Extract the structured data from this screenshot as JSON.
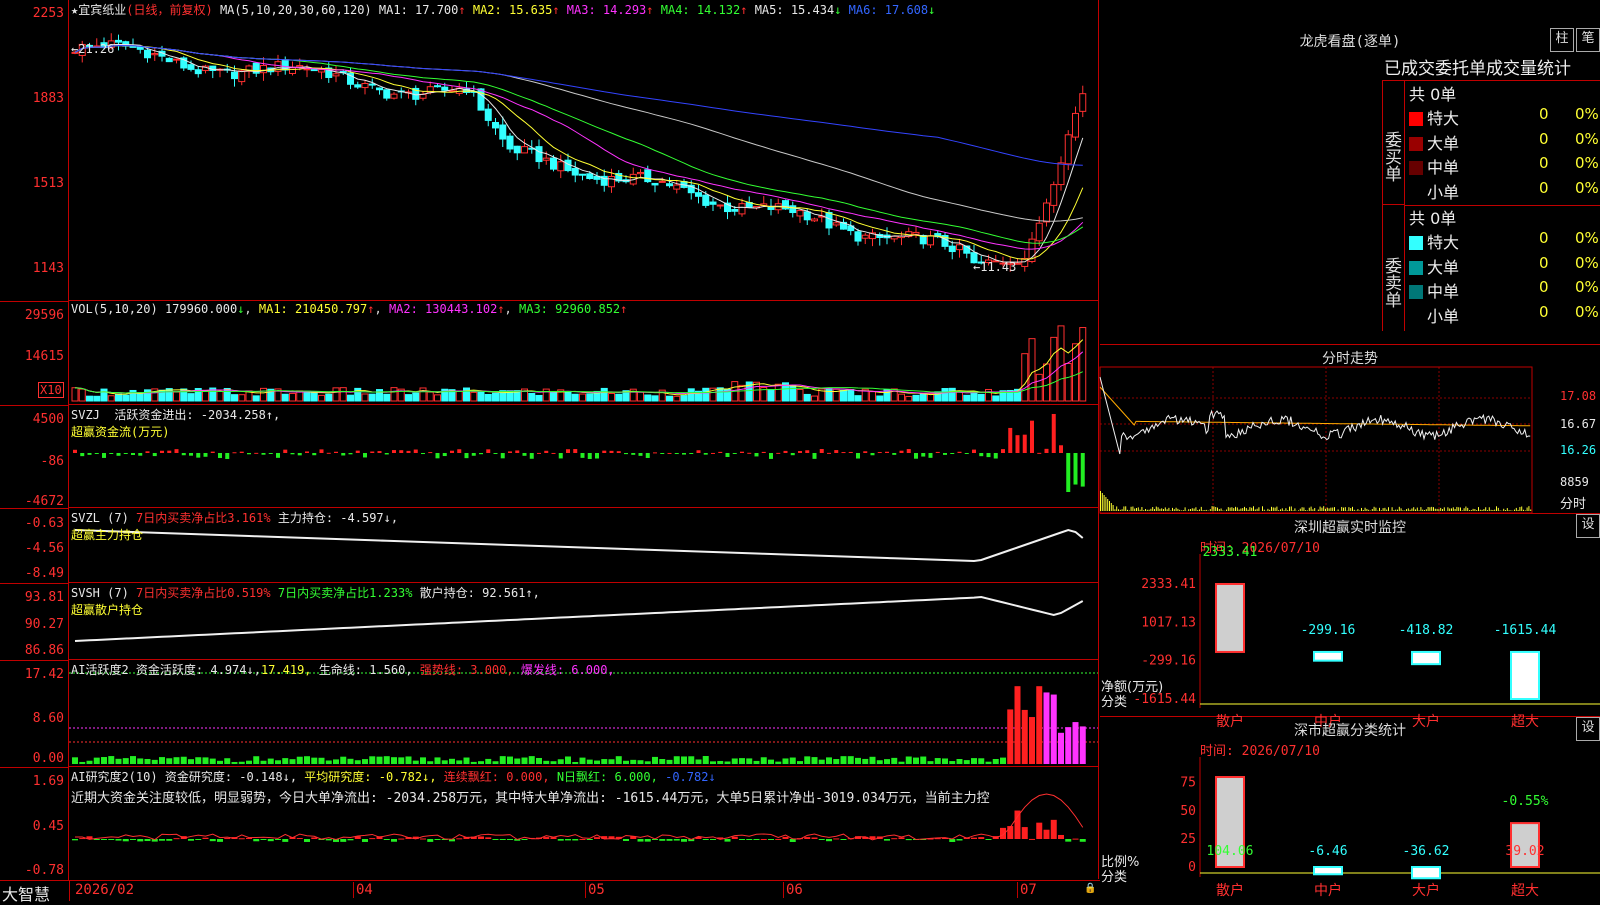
{
  "app": {
    "name": "大智慧"
  },
  "stock": {
    "name": "宜宾纸业",
    "period": "(日线，前复权)"
  },
  "main_panel": {
    "yticks": [
      "2253",
      "1883",
      "1513",
      "1143"
    ],
    "ma_label": "MA(5,10,20,30,60,120)",
    "ma": [
      {
        "label": "MA1: 17.700",
        "arrow": "↑",
        "color": "#e8e8e8"
      },
      {
        "label": "MA2: 15.635",
        "arrow": "↑",
        "color": "#ffff33"
      },
      {
        "label": "MA3: 14.293",
        "arrow": "↑",
        "color": "#ff33ff"
      },
      {
        "label": "MA4: 14.132",
        "arrow": "↑",
        "color": "#33ff33"
      },
      {
        "label": "MA5: 15.434",
        "arrow": "↓",
        "color": "#e8e8e8"
      },
      {
        "label": "MA6: 17.608",
        "arrow": "↓",
        "color": "#3366ff"
      }
    ],
    "high_marker": "←21.26",
    "low_marker": "←11.43"
  },
  "vol_panel": {
    "yticks": [
      "29596",
      "14615"
    ],
    "unit": "X10",
    "title": "VOL(5,10,20)",
    "vol": "179960.000",
    "vol_arrow": "↓",
    "ma1": "MA1: 210450.797",
    "ma2": "MA2: 130443.102",
    "ma3": "MA3: 92960.852",
    "arrow_up": "↑"
  },
  "svzj_panel": {
    "yticks": [
      "4500",
      "-86",
      "-4672"
    ],
    "title": "SVZJ",
    "line1": "活跃资金进出: -2034.258↑,",
    "line2": "超赢资金流(万元)"
  },
  "svzl_panel": {
    "yticks": [
      "-0.63",
      "-4.56",
      "-8.49"
    ],
    "title": "SVZL (7)",
    "seg1": "7日内买卖净占比3.161%",
    "seg2": "主力持仓: -4.597↓,",
    "line2": "超赢主力持仓"
  },
  "svsh_panel": {
    "yticks": [
      "93.81",
      "90.27",
      "86.86"
    ],
    "title": "SVSH (7)",
    "seg1": "7日内买卖净占比0.519%",
    "seg2": "7日内买卖净占比1.233%",
    "seg3": "散户持仓: 92.561↑,",
    "line2": "超赢散户持仓"
  },
  "ai1_panel": {
    "yticks": [
      "17.42",
      "8.60",
      "0.00"
    ],
    "title": "AI活跃度2",
    "seg1": "资金活跃度: 4.974↓,",
    "seg2": "17.419,",
    "seg3": "生命线: 1.560,",
    "seg4": "强势线: 3.000,",
    "seg5": "爆发线: 6.000,"
  },
  "ai2_panel": {
    "yticks": [
      "1.69",
      "0.45",
      "-0.78"
    ],
    "title": "AI研究度2(10)",
    "seg1": "资金研究度: -0.148↓,",
    "seg2": "平均研究度: -0.782↓,",
    "seg3": "连续飘红: 0.000,",
    "seg4": "N日飘红: 6.000,",
    "seg5": "-0.782↓",
    "comment": "近期大资金关注度较低，明显弱势，今日大单净流出: -2034.258万元，其中特大单净流出: -1615.44万元，大单5日累计净出-3019.034万元，当前主力控"
  },
  "xaxis": {
    "labels": [
      "2026/02",
      "04",
      "05",
      "06",
      "07"
    ]
  },
  "right": {
    "lhb": {
      "title": "龙虎看盘(逐单)",
      "btn1": "柱",
      "btn2": "笔",
      "subtitle": "已成交委托单成交量统计"
    },
    "buy": {
      "side_label": "委买单",
      "total": "共 0单",
      "rows": [
        {
          "label": "特大",
          "count": "0",
          "pct": "0%",
          "color": "#ff0000"
        },
        {
          "label": "大单",
          "count": "0",
          "pct": "0%",
          "color": "#990000"
        },
        {
          "label": "中单",
          "count": "0",
          "pct": "0%",
          "color": "#660000"
        },
        {
          "label": "小单",
          "count": "0",
          "pct": "0%",
          "color": "#000000"
        }
      ]
    },
    "sell": {
      "side_label": "委卖单",
      "total": "共 0单",
      "rows": [
        {
          "label": "特大",
          "count": "0",
          "pct": "0%",
          "color": "#33ffff"
        },
        {
          "label": "大单",
          "count": "0",
          "pct": "0%",
          "color": "#009999"
        },
        {
          "label": "中单",
          "count": "0",
          "pct": "0%",
          "color": "#007777"
        },
        {
          "label": "小单",
          "count": "0",
          "pct": "0%",
          "color": "#000000"
        }
      ]
    },
    "intraday": {
      "title": "分时走势",
      "yticks": [
        "17.08",
        "16.67",
        "16.26"
      ],
      "vol_tick": "8859",
      "vol_label": "分时"
    },
    "monitor": {
      "title": "深圳超赢实时监控",
      "btn": "设",
      "time": "时间: 2026/07/10",
      "yticks": [
        "2333.41",
        "1017.13",
        "-299.16",
        "-1615.44"
      ],
      "ylabel1": "净额(万元)",
      "ylabel2": "分类"
    },
    "classify": {
      "title": "深市超赢分类统计",
      "btn": "设",
      "time": "时间: 2026/07/10",
      "yticks": [
        "75",
        "50",
        "25",
        "0"
      ],
      "ylabel1": "比例%",
      "ylabel2": "分类"
    }
  },
  "chart_data": [
    {
      "type": "bar",
      "title": "深圳超赢实时监控",
      "ylabel": "净额(万元)",
      "xlabel": "分类",
      "categories": [
        "散户",
        "中户",
        "大户",
        "超大"
      ],
      "values": [
        2333.41,
        -299.16,
        -418.82,
        -1615.44
      ],
      "ylim": [
        -1615.44,
        2333.41
      ]
    },
    {
      "type": "bar",
      "title": "深市超赢分类统计",
      "ylabel": "比例%",
      "xlabel": "分类",
      "categories": [
        "散户",
        "中户",
        "大户",
        "超大"
      ],
      "values": [
        104.06,
        -6.46,
        -36.62,
        39.02
      ],
      "annotation": "-0.55%",
      "ylim": [
        0,
        75
      ]
    }
  ]
}
